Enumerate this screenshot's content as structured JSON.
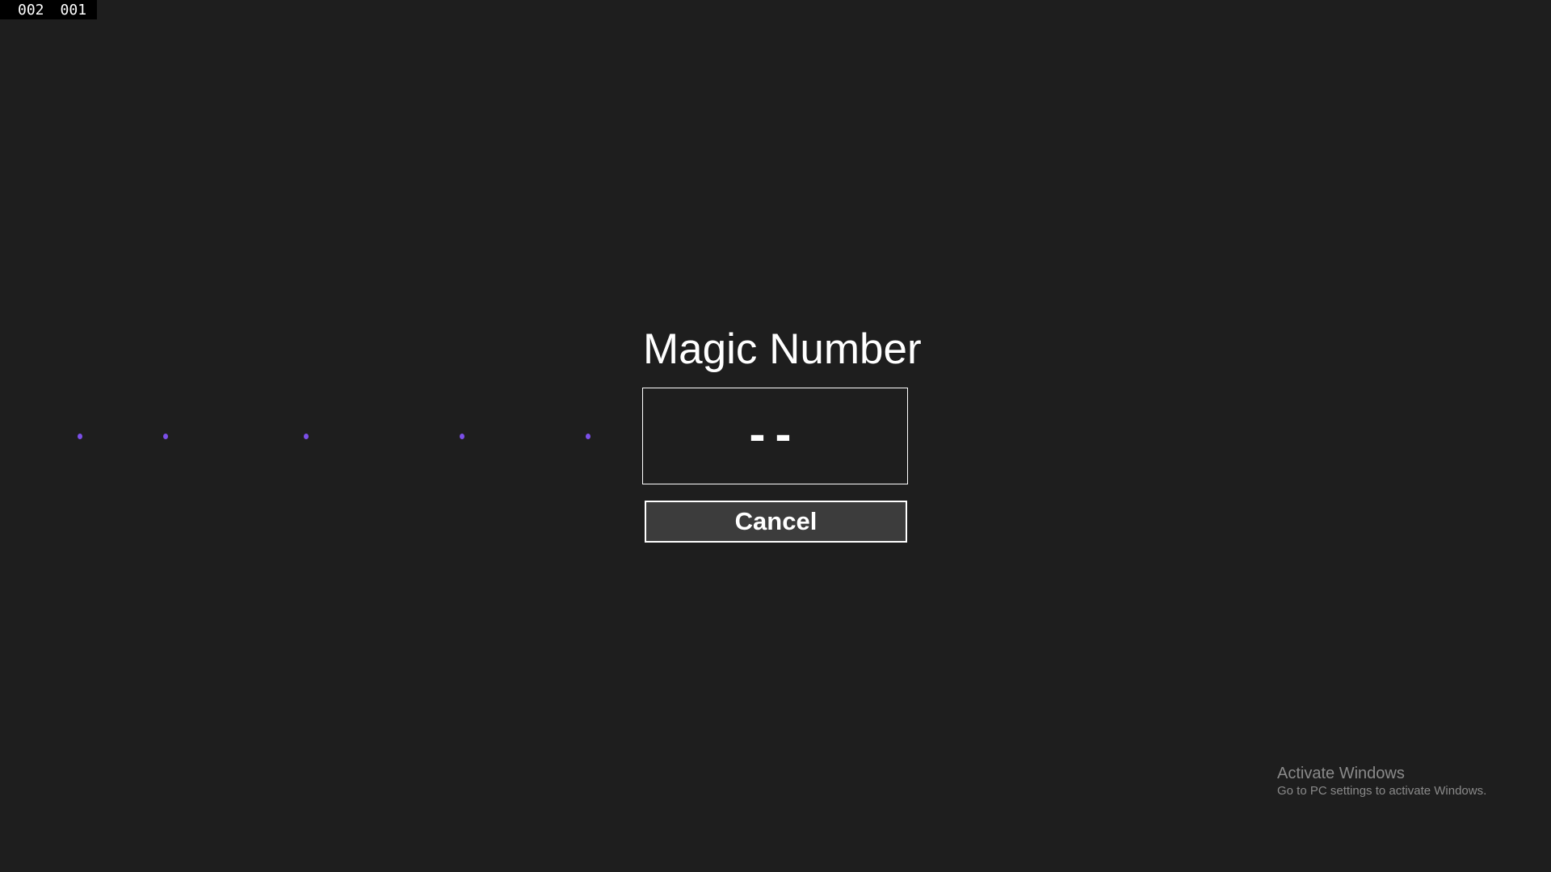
{
  "counter": {
    "left": "002",
    "right": "001"
  },
  "dialog": {
    "title": "Magic Number",
    "value": "--",
    "cancel_label": "Cancel"
  },
  "progress_dots": {
    "count": 5,
    "color": "#7b4fe8"
  },
  "watermark": {
    "title": "Activate Windows",
    "subtitle": "Go to PC settings to activate Windows."
  },
  "colors": {
    "background": "#1e1e1e",
    "button": "#3c3c3c"
  }
}
